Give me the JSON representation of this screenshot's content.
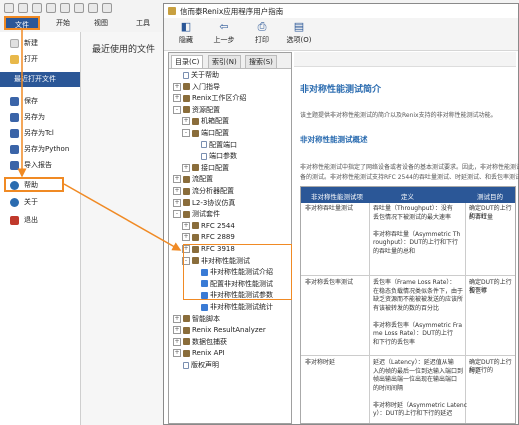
{
  "ribbon": {
    "tabs": [
      "文件",
      "开始",
      "视图",
      "工具"
    ]
  },
  "backstage": {
    "items": [
      {
        "label": "新建",
        "icon": "new-file-icon",
        "color": "#d0d0d0"
      },
      {
        "label": "打开",
        "icon": "open-folder-icon",
        "color": "#e8b84a"
      },
      {
        "label": "最近打开文件",
        "icon": "",
        "color": ""
      },
      {
        "label": "保存",
        "icon": "save-icon",
        "color": "#3a64a8"
      },
      {
        "label": "另存为",
        "icon": "save-as-icon",
        "color": "#3a64a8"
      },
      {
        "label": "另存为Tcl",
        "icon": "save-tcl-icon",
        "color": "#3a64a8"
      },
      {
        "label": "另存为Python",
        "icon": "save-python-icon",
        "color": "#3a64a8"
      },
      {
        "label": "导入报告",
        "icon": "import-report-icon",
        "color": "#3a64a8"
      },
      {
        "label": "帮助",
        "icon": "help-icon",
        "color": "#2b6cb0"
      },
      {
        "label": "关于",
        "icon": "about-icon",
        "color": "#2b6cb0"
      },
      {
        "label": "退出",
        "icon": "exit-icon",
        "color": "#c0392b"
      }
    ],
    "recent_title": "最近使用的文件"
  },
  "help_window": {
    "title": "信而泰Renix应用程序用户指南",
    "toolbar": [
      "隐藏",
      "上一步",
      "打印",
      "选项(O)"
    ],
    "nav_tabs": [
      "目录(C)",
      "索引(N)",
      "搜索(S)"
    ],
    "tree": [
      {
        "label": "关于帮助",
        "level": 0,
        "type": "page",
        "toggle": ""
      },
      {
        "label": "入门指导",
        "level": 0,
        "type": "book",
        "toggle": "+"
      },
      {
        "label": "Renix工作区介绍",
        "level": 0,
        "type": "book",
        "toggle": "+"
      },
      {
        "label": "资源配置",
        "level": 0,
        "type": "book",
        "toggle": "-"
      },
      {
        "label": "机箱配置",
        "level": 1,
        "type": "book",
        "toggle": "+"
      },
      {
        "label": "端口配置",
        "level": 1,
        "type": "book",
        "toggle": "-"
      },
      {
        "label": "配置端口",
        "level": 2,
        "type": "page",
        "toggle": ""
      },
      {
        "label": "端口参数",
        "level": 2,
        "type": "page",
        "toggle": ""
      },
      {
        "label": "接口配置",
        "level": 1,
        "type": "book",
        "toggle": "+"
      },
      {
        "label": "流配置",
        "level": 0,
        "type": "book",
        "toggle": "+"
      },
      {
        "label": "流分析器配置",
        "level": 0,
        "type": "book",
        "toggle": "+"
      },
      {
        "label": "L2-3协议仿真",
        "level": 0,
        "type": "book",
        "toggle": "+"
      },
      {
        "label": "测试套件",
        "level": 0,
        "type": "book",
        "toggle": "-"
      },
      {
        "label": "RFC 2544",
        "level": 1,
        "type": "book",
        "toggle": "+"
      },
      {
        "label": "RFC 2889",
        "level": 1,
        "type": "book",
        "toggle": "+"
      },
      {
        "label": "RFC 3918",
        "level": 1,
        "type": "book",
        "toggle": "+"
      },
      {
        "label": "非对称性能测试",
        "level": 1,
        "type": "book",
        "toggle": "-"
      },
      {
        "label": "非对称性能测试介绍",
        "level": 2,
        "type": "q",
        "toggle": ""
      },
      {
        "label": "配置非对称性能测试",
        "level": 2,
        "type": "q",
        "toggle": ""
      },
      {
        "label": "非对称性能测试参数",
        "level": 2,
        "type": "q",
        "toggle": ""
      },
      {
        "label": "非对称性能测试统计",
        "level": 2,
        "type": "q",
        "toggle": ""
      },
      {
        "label": "智能脚本",
        "level": 0,
        "type": "book",
        "toggle": "+"
      },
      {
        "label": "Renix ResultAnalyzer",
        "level": 0,
        "type": "book",
        "toggle": "+"
      },
      {
        "label": "数据包捕获",
        "level": 0,
        "type": "book",
        "toggle": "+"
      },
      {
        "label": "Renix API",
        "level": 0,
        "type": "book",
        "toggle": "+"
      },
      {
        "label": "版权声明",
        "level": 0,
        "type": "page",
        "toggle": ""
      }
    ],
    "content": {
      "heading": "非对称性能测试简介",
      "intro": "该主题提供非对称性能测试的简介以及Renix支持的非对称性能测试功能。",
      "subheading": "非对称性能测试概述",
      "desc_line1": "非对称性能测试中指定了网络设备或者设备的基本测试要求。因此，非对称性能测试是一",
      "desc_line2": "备的测试。非对称性能测试支持RFC 2544的吞吐量测试、时延测试、和丢包率测试，主",
      "table_headers": [
        "非对称性能测试项",
        "定义",
        "测试目的"
      ],
      "rows": [
        {
          "item": "非对称吞吐量测试",
          "def": [
            "吞吐量（Throughput）：没有",
            "丢包情况下被测试的最大速率",
            "",
            "非对称吞吐量（Asymmetric Th",
            "roughput）：DUT的上行和下行",
            "的吞吐量的总和"
          ],
          "purpose": [
            "确定DUT的上行和下行",
            "的吞吐量"
          ]
        },
        {
          "item": "非对称丢包率测试",
          "def": [
            "丢包率（Frame Loss Rate）：",
            "在稳态负载情况类似条件下，由于",
            "缺乏资源而不能被被发送的应该所",
            "有该被转发的数的百分比",
            "",
            "非对称丢包率（Asymmetric Fra",
            "me Loss Rate）：DUT的上行",
            "和下行的丢包率"
          ],
          "purpose": [
            "确定DUT的上行和下行",
            "丢包率"
          ]
        },
        {
          "item": "非对称时延",
          "def": [
            "延迟（Latency）：延迟值从输",
            "入的帧的最后一位到达输入端口到",
            "帧出输出端一位出现在输出端口",
            "的时间间隔",
            "",
            "非对称时延（Asymmetric Latenc",
            "y）：DUT的上行和下行的延迟"
          ],
          "purpose": [
            "确定DUT的上行和下行的",
            "时延"
          ]
        }
      ]
    }
  },
  "colors": {
    "accent": "#2b5797",
    "highlight": "#f08a24",
    "heading": "#2b6cb0"
  }
}
